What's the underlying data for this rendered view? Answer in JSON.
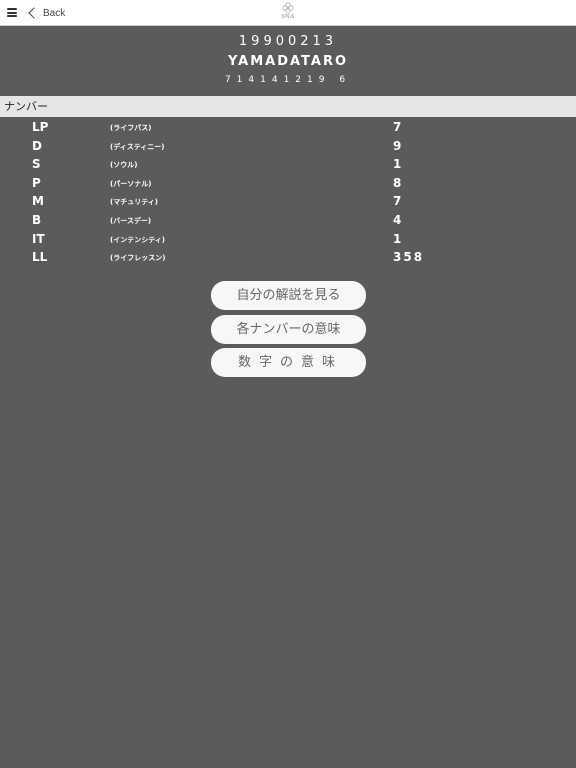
{
  "navbar": {
    "back_label": "Back",
    "logo_text": "SNA"
  },
  "profile": {
    "birthdate": "19900213",
    "name": "YAMADATARO",
    "digits": "714141219 6"
  },
  "section": {
    "title": "ナンバー"
  },
  "numbers": [
    {
      "code": "LP",
      "label": "(ライフパス)",
      "value": "7"
    },
    {
      "code": "D",
      "label": "(ディスティニー)",
      "value": "9"
    },
    {
      "code": "S",
      "label": "(ソウル)",
      "value": "1"
    },
    {
      "code": "P",
      "label": "(パーソナル)",
      "value": "8"
    },
    {
      "code": "M",
      "label": "(マチュリティ)",
      "value": "7"
    },
    {
      "code": "B",
      "label": "(バースデー)",
      "value": "4"
    },
    {
      "code": "IT",
      "label": "(インテンシティ)",
      "value": "1"
    },
    {
      "code": "LL",
      "label": "(ライフレッスン)",
      "value": "358"
    }
  ],
  "buttons": {
    "my_explanation": "自分の解説を見る",
    "number_meanings": "各ナンバーの意味",
    "digit_meanings": "数字の意味"
  },
  "colors": {
    "background": "#5b5b5b",
    "navbar": "#ffffff",
    "section_header": "#e6e6e6",
    "button": "#f7f7f7"
  }
}
